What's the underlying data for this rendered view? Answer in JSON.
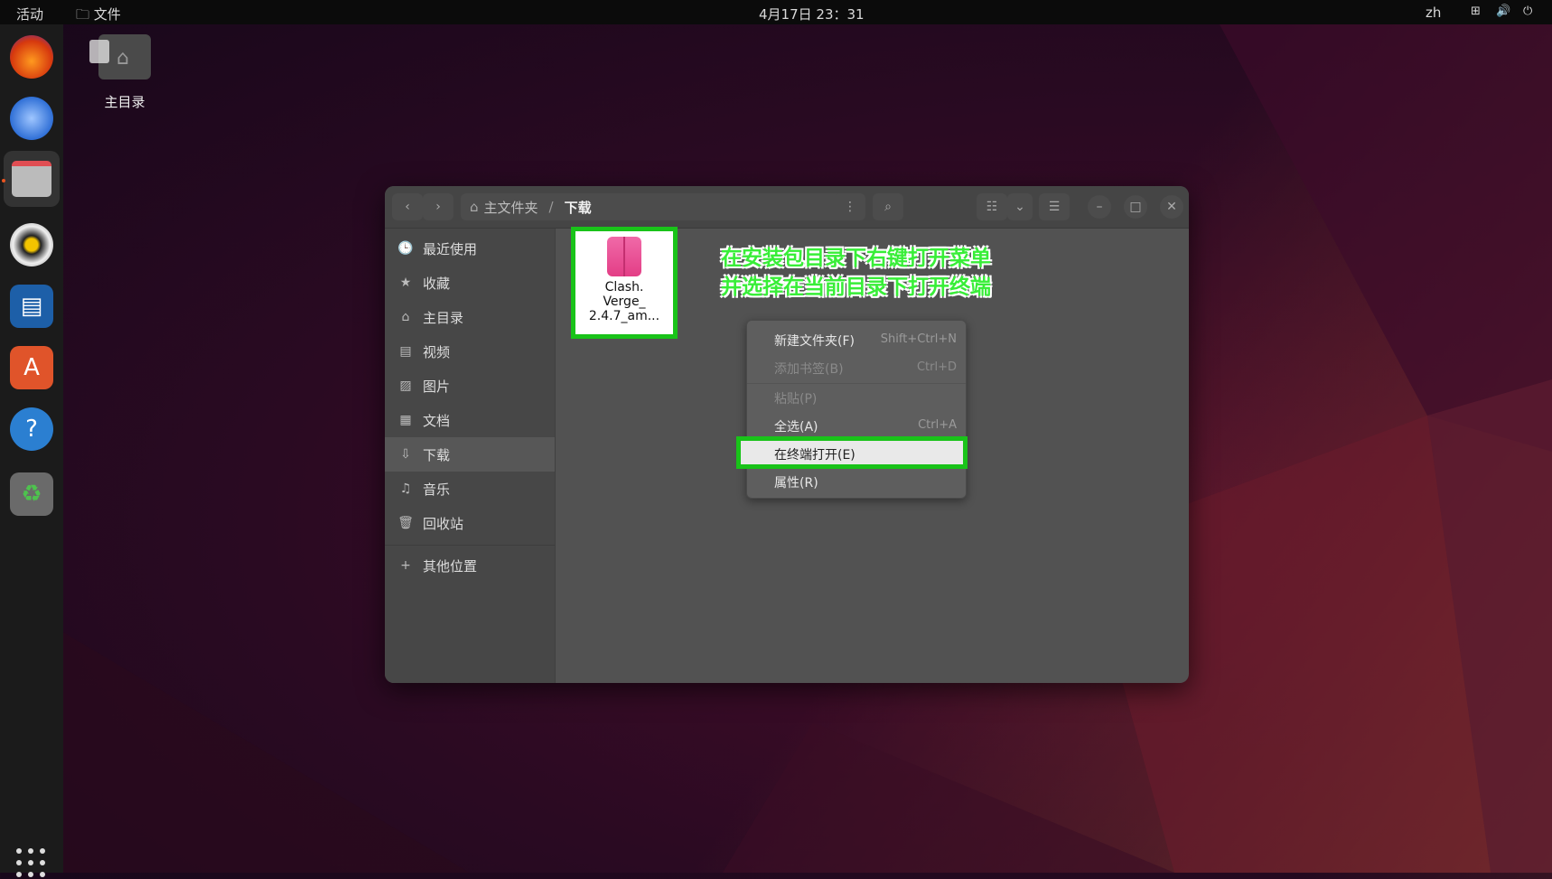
{
  "topbar": {
    "activities": "活动",
    "app_label": "文件",
    "clock": "4月17日  23：31",
    "lang": "zh"
  },
  "desktop": {
    "home_label": "主目录"
  },
  "window": {
    "path": {
      "home": "主文件夹",
      "separator": "/",
      "current": "下载"
    },
    "sidebar": {
      "items": [
        {
          "icon": "🕒",
          "label": "最近使用"
        },
        {
          "icon": "★",
          "label": "收藏"
        },
        {
          "icon": "⌂",
          "label": "主目录"
        },
        {
          "icon": "▤",
          "label": "视频"
        },
        {
          "icon": "▨",
          "label": "图片"
        },
        {
          "icon": "▦",
          "label": "文档"
        },
        {
          "icon": "⇩",
          "label": "下载"
        },
        {
          "icon": "♫",
          "label": "音乐"
        },
        {
          "icon": "🗑",
          "label": "回收站"
        }
      ],
      "other_locations": {
        "icon": "+",
        "label": "其他位置"
      }
    },
    "file": {
      "name_line1": "Clash.",
      "name_line2": "Verge_",
      "name_line3": "2.4.7_am..."
    },
    "annotation": {
      "line1": "在安装包目录下右键打开菜单",
      "line2": "并选择在当前目录下打开终端"
    },
    "context_menu": {
      "items": [
        {
          "label": "新建文件夹(F)",
          "accel": "Shift+Ctrl+N",
          "disabled": false
        },
        {
          "label": "添加书签(B)",
          "accel": "Ctrl+D",
          "disabled": true
        },
        {
          "label": "粘贴(P)",
          "accel": "",
          "disabled": true
        },
        {
          "label": "全选(A)",
          "accel": "Ctrl+A",
          "disabled": false
        },
        {
          "label": "在终端打开(E)",
          "accel": "",
          "disabled": false
        },
        {
          "label": "属性(R)",
          "accel": "",
          "disabled": false
        }
      ]
    }
  },
  "colors": {
    "highlight_green": "#19c319",
    "annotation_green": "#38ee38"
  }
}
